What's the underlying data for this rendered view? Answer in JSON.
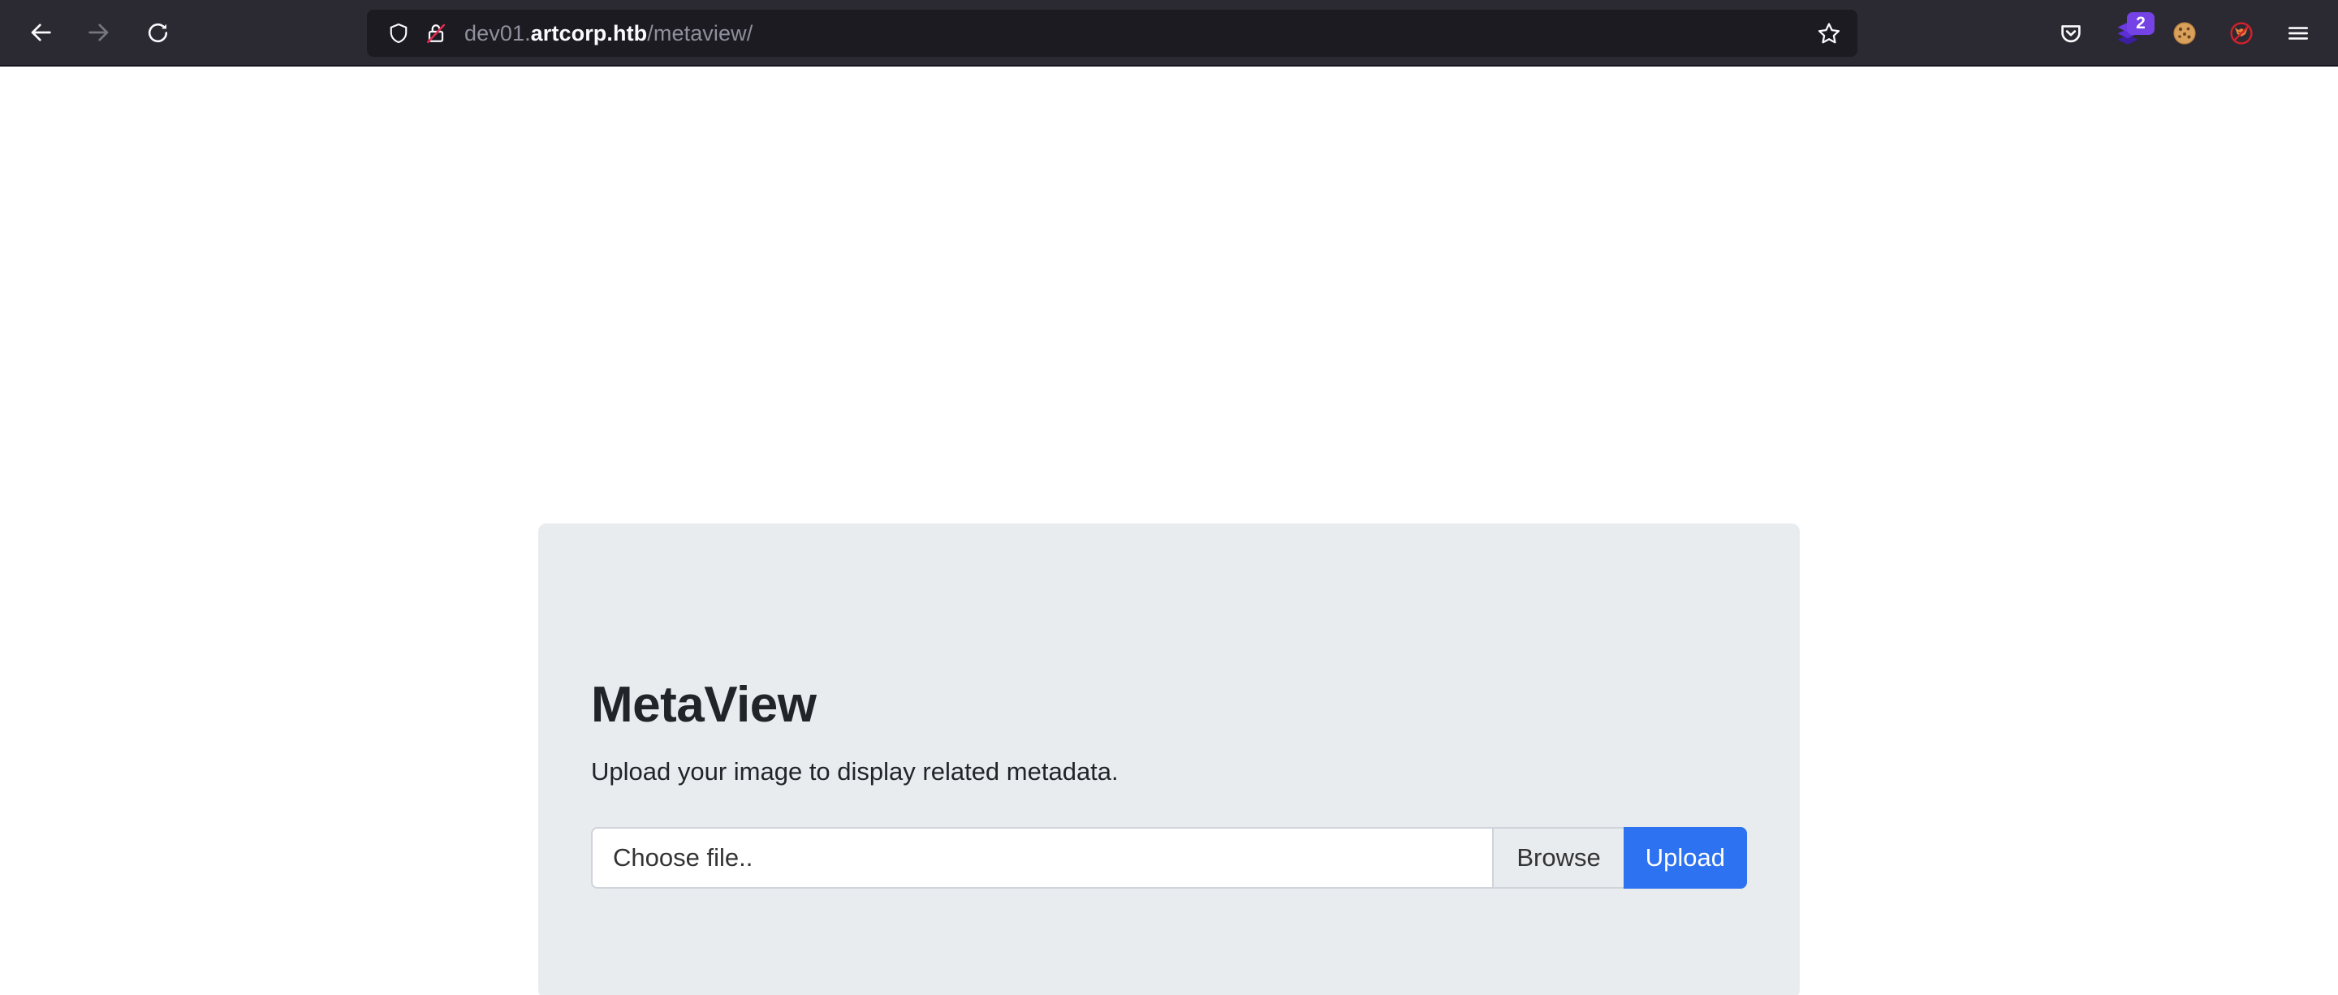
{
  "browser": {
    "nav": {
      "back_label": "Back",
      "back_icon": "arrow-left-icon",
      "forward_label": "Forward",
      "forward_icon": "arrow-right-icon",
      "reload_label": "Reload",
      "reload_icon": "reload-icon"
    },
    "urlbar": {
      "shield_icon": "shield-icon",
      "security_icon": "padlock-crossed-icon",
      "url_prefix": "dev01.",
      "url_host": "artcorp.htb",
      "url_path": "/metaview/",
      "full_url": "dev01.artcorp.htb/metaview/",
      "bookmark_icon": "star-icon",
      "bookmark_label": "Bookmark this page"
    },
    "toolbar_right": [
      {
        "name": "pocket-icon",
        "label": "Save to Pocket",
        "glyph": ""
      },
      {
        "name": "extension-layers-icon",
        "label": "Extension",
        "glyph": "",
        "badge": "2"
      },
      {
        "name": "cookie-icon",
        "label": "Cookie Manager",
        "glyph": "🍪"
      },
      {
        "name": "no-fox-icon",
        "label": "FoxyProxy Disabled",
        "glyph": ""
      },
      {
        "name": "hamburger-menu-icon",
        "label": "Open application menu",
        "glyph": ""
      }
    ]
  },
  "page": {
    "card": {
      "title": "MetaView",
      "subtitle": "Upload your image to display related metadata.",
      "upload_form": {
        "file_input_text": "Choose file..",
        "file_input_placeholder": "Choose file..",
        "browse_label": "Browse",
        "upload_label": "Upload"
      }
    }
  },
  "colors": {
    "chrome_bg": "#2b2a33",
    "urlbar_bg": "#1c1b22",
    "page_bg": "#ffffff",
    "card_bg": "#e9ecef",
    "accent_blue": "#2d72f0",
    "badge_purple": "#7542e5",
    "text_dark": "#212529",
    "text_muted": "#8f8f9d"
  }
}
